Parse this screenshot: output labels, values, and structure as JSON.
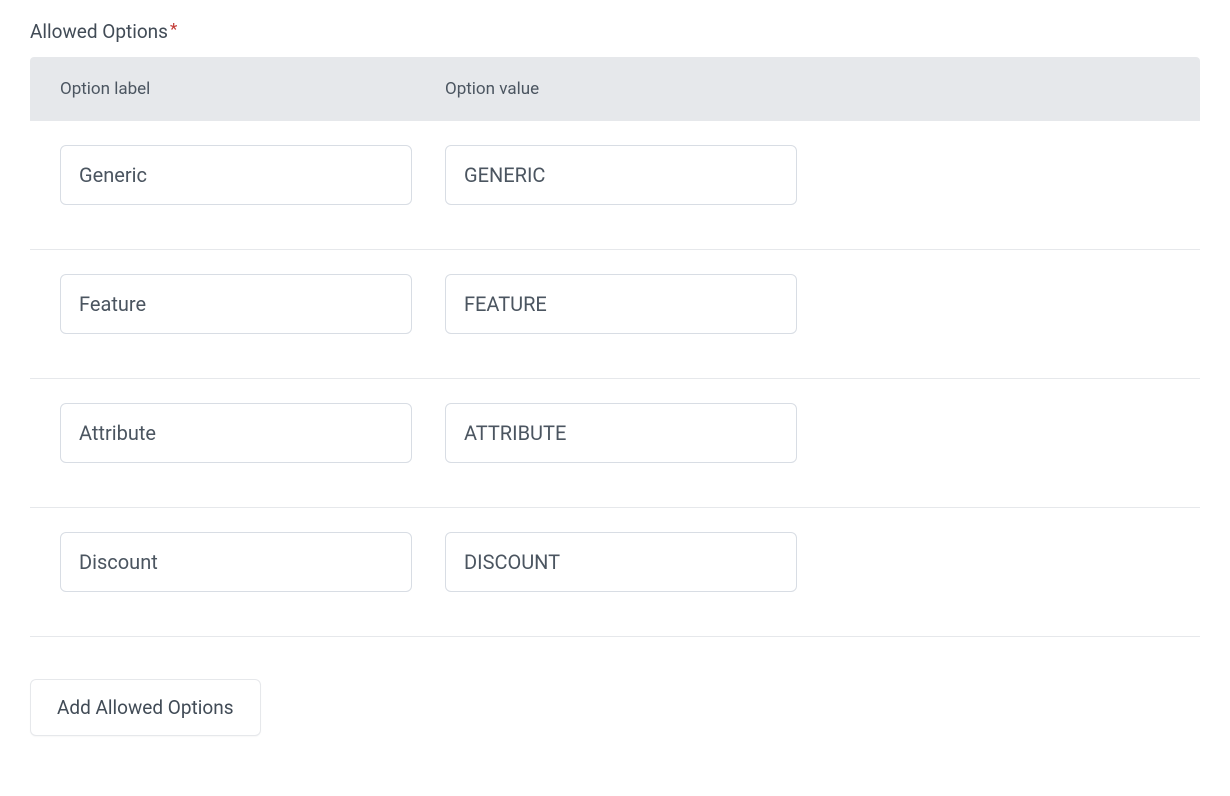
{
  "section": {
    "title": "Allowed Options",
    "required_mark": "*"
  },
  "headers": {
    "label": "Option label",
    "value": "Option value"
  },
  "options": [
    {
      "label": "Generic",
      "value": "GENERIC"
    },
    {
      "label": "Feature",
      "value": "FEATURE"
    },
    {
      "label": "Attribute",
      "value": "ATTRIBUTE"
    },
    {
      "label": "Discount",
      "value": "DISCOUNT"
    }
  ],
  "buttons": {
    "add_option": "Add Allowed Options"
  }
}
